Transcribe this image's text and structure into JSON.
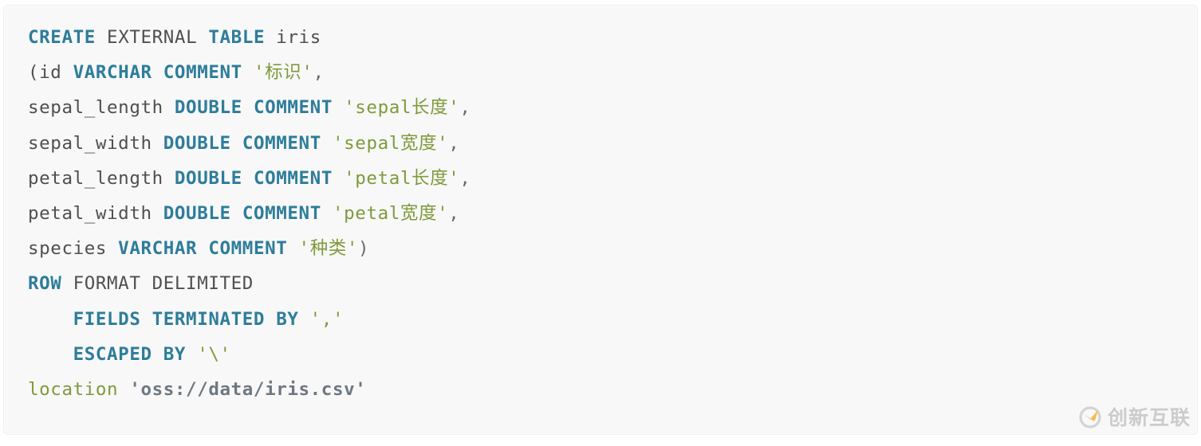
{
  "code_block": {
    "language": "sql",
    "background_color": "#f8f8f8",
    "colors": {
      "keyword": "#2d7d9a",
      "plain": "#4f4f4f",
      "string": "#7f9a3c",
      "path_string": "#6e7781",
      "punctuation": "#6a6a6a"
    },
    "lines": [
      {
        "index": 1,
        "indent": "",
        "text": "CREATE EXTERNAL TABLE iris",
        "tokens": [
          {
            "t": "CREATE",
            "c": "kw"
          },
          {
            "t": " ",
            "c": "plain"
          },
          {
            "t": "EXTERNAL",
            "c": "plain"
          },
          {
            "t": " ",
            "c": "plain"
          },
          {
            "t": "TABLE",
            "c": "kw"
          },
          {
            "t": " iris",
            "c": "plain"
          }
        ]
      },
      {
        "index": 2,
        "indent": "",
        "text": "(id VARCHAR COMMENT '标识',",
        "tokens": [
          {
            "t": "(id ",
            "c": "plain"
          },
          {
            "t": "VARCHAR",
            "c": "kw"
          },
          {
            "t": " ",
            "c": "plain"
          },
          {
            "t": "COMMENT",
            "c": "kw"
          },
          {
            "t": " ",
            "c": "plain"
          },
          {
            "t": "'标识'",
            "c": "str"
          },
          {
            "t": ",",
            "c": "punc"
          }
        ]
      },
      {
        "index": 3,
        "indent": "",
        "text": "sepal_length DOUBLE COMMENT 'sepal长度',",
        "tokens": [
          {
            "t": "sepal_length ",
            "c": "plain"
          },
          {
            "t": "DOUBLE",
            "c": "kw"
          },
          {
            "t": " ",
            "c": "plain"
          },
          {
            "t": "COMMENT",
            "c": "kw"
          },
          {
            "t": " ",
            "c": "plain"
          },
          {
            "t": "'sepal长度'",
            "c": "str"
          },
          {
            "t": ",",
            "c": "punc"
          }
        ]
      },
      {
        "index": 4,
        "indent": "",
        "text": "sepal_width DOUBLE COMMENT 'sepal宽度',",
        "tokens": [
          {
            "t": "sepal_width ",
            "c": "plain"
          },
          {
            "t": "DOUBLE",
            "c": "kw"
          },
          {
            "t": " ",
            "c": "plain"
          },
          {
            "t": "COMMENT",
            "c": "kw"
          },
          {
            "t": " ",
            "c": "plain"
          },
          {
            "t": "'sepal宽度'",
            "c": "str"
          },
          {
            "t": ",",
            "c": "punc"
          }
        ]
      },
      {
        "index": 5,
        "indent": "",
        "text": "petal_length DOUBLE COMMENT 'petal长度',",
        "tokens": [
          {
            "t": "petal_length ",
            "c": "plain"
          },
          {
            "t": "DOUBLE",
            "c": "kw"
          },
          {
            "t": " ",
            "c": "plain"
          },
          {
            "t": "COMMENT",
            "c": "kw"
          },
          {
            "t": " ",
            "c": "plain"
          },
          {
            "t": "'petal长度'",
            "c": "str"
          },
          {
            "t": ",",
            "c": "punc"
          }
        ]
      },
      {
        "index": 6,
        "indent": "",
        "text": "petal_width DOUBLE COMMENT 'petal宽度',",
        "tokens": [
          {
            "t": "petal_width ",
            "c": "plain"
          },
          {
            "t": "DOUBLE",
            "c": "kw"
          },
          {
            "t": " ",
            "c": "plain"
          },
          {
            "t": "COMMENT",
            "c": "kw"
          },
          {
            "t": " ",
            "c": "plain"
          },
          {
            "t": "'petal宽度'",
            "c": "str"
          },
          {
            "t": ",",
            "c": "punc"
          }
        ]
      },
      {
        "index": 7,
        "indent": "",
        "text": "species VARCHAR COMMENT '种类')",
        "tokens": [
          {
            "t": "species ",
            "c": "plain"
          },
          {
            "t": "VARCHAR",
            "c": "kw"
          },
          {
            "t": " ",
            "c": "plain"
          },
          {
            "t": "COMMENT",
            "c": "kw"
          },
          {
            "t": " ",
            "c": "plain"
          },
          {
            "t": "'种类'",
            "c": "str"
          },
          {
            "t": ")",
            "c": "punc"
          }
        ]
      },
      {
        "index": 8,
        "indent": "",
        "text": "ROW FORMAT DELIMITED",
        "tokens": [
          {
            "t": "ROW",
            "c": "kw"
          },
          {
            "t": " FORMAT DELIMITED",
            "c": "plain"
          }
        ]
      },
      {
        "index": 9,
        "indent": "    ",
        "text": "    FIELDS TERMINATED BY ','",
        "tokens": [
          {
            "t": "    ",
            "c": "plain"
          },
          {
            "t": "FIELDS TERMINATED BY ",
            "c": "kw"
          },
          {
            "t": "','",
            "c": "str"
          }
        ]
      },
      {
        "index": 10,
        "indent": "    ",
        "text": "    ESCAPED BY '\\'",
        "tokens": [
          {
            "t": "    ",
            "c": "plain"
          },
          {
            "t": "ESCAPED BY ",
            "c": "kw"
          },
          {
            "t": "'\\'",
            "c": "str"
          }
        ]
      },
      {
        "index": 11,
        "indent": "",
        "text": "location 'oss://data/iris.csv'",
        "tokens": [
          {
            "t": "location",
            "c": "str"
          },
          {
            "t": " ",
            "c": "plain"
          },
          {
            "t": "'oss://data/iris.csv'",
            "c": "path"
          }
        ]
      }
    ]
  },
  "watermark": {
    "text": "创新互联",
    "icon": "swoosh-circle-logo",
    "logo_circle_color": "#d4d4d4",
    "logo_accent_color": "#f5a623",
    "text_color": "#c9c9c9"
  }
}
